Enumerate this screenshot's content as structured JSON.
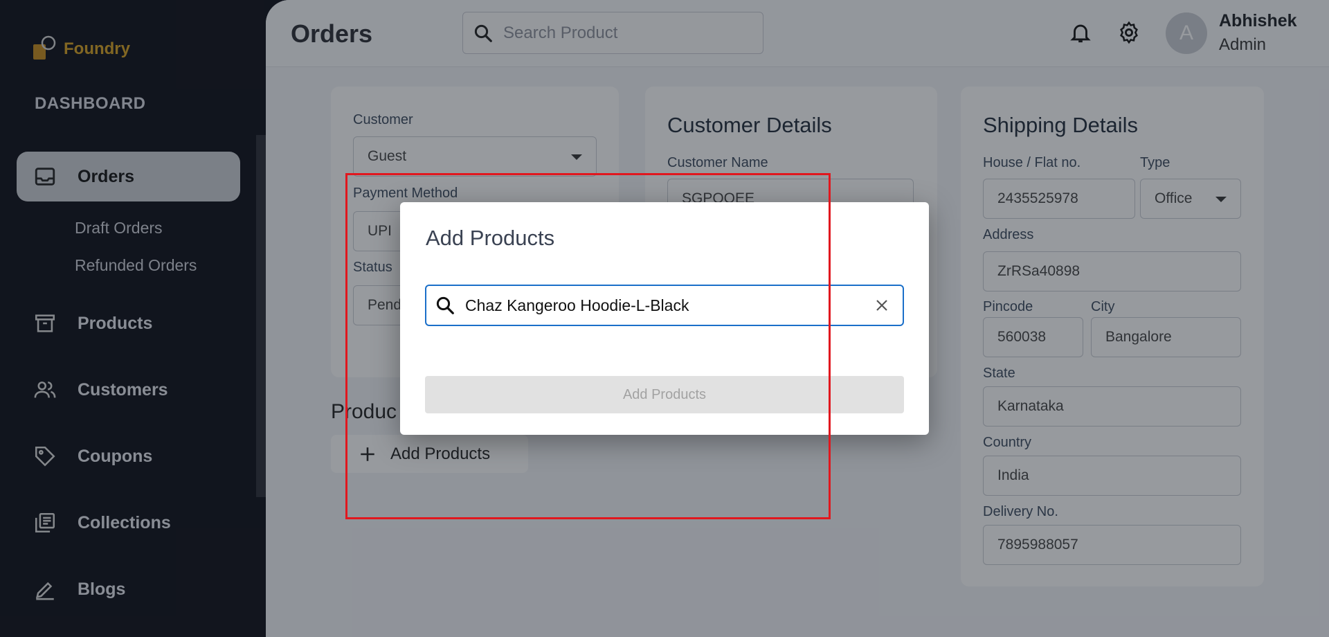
{
  "brand": {
    "name": "Foundry",
    "accent": "#d9a21f"
  },
  "sidebar": {
    "section_label": "DASHBOARD",
    "items": [
      {
        "label": "Orders",
        "icon": "inbox-icon",
        "active": true
      },
      {
        "label": "Products",
        "icon": "archive-icon"
      },
      {
        "label": "Customers",
        "icon": "users-icon"
      },
      {
        "label": "Coupons",
        "icon": "tag-icon"
      },
      {
        "label": "Collections",
        "icon": "library-icon"
      },
      {
        "label": "Blogs",
        "icon": "edit-icon"
      }
    ],
    "sub_items": [
      "Draft Orders",
      "Refunded Orders"
    ]
  },
  "header": {
    "title": "Orders",
    "search_placeholder": "Search Product",
    "user": {
      "initial": "A",
      "name": "Abhishek",
      "role": "Admin"
    }
  },
  "order_form": {
    "customer_label": "Customer",
    "customer_value": "Guest",
    "payment_label": "Payment Method",
    "payment_value": "UPI",
    "status_label": "Status",
    "status_value": "Pend"
  },
  "customer_details": {
    "title": "Customer Details",
    "name_label": "Customer Name",
    "name_value": "SGPQQEE"
  },
  "shipping": {
    "title": "Shipping Details",
    "house_label": "House / Flat no.",
    "house_value": "2435525978",
    "type_label": "Type",
    "type_value": "Office",
    "address_label": "Address",
    "address_value": "ZrRSa40898",
    "pincode_label": "Pincode",
    "pincode_value": "560038",
    "city_label": "City",
    "city_value": "Bangalore",
    "state_label": "State",
    "state_value": "Karnataka",
    "country_label": "Country",
    "country_value": "India",
    "delivery_label": "Delivery No.",
    "delivery_value": "7895988057"
  },
  "products_section": {
    "heading": "Produc",
    "add_button": "Add Products"
  },
  "modal": {
    "title": "Add Products",
    "search_value": "Chaz Kangeroo Hoodie-L-Black",
    "submit_label": "Add Products"
  }
}
